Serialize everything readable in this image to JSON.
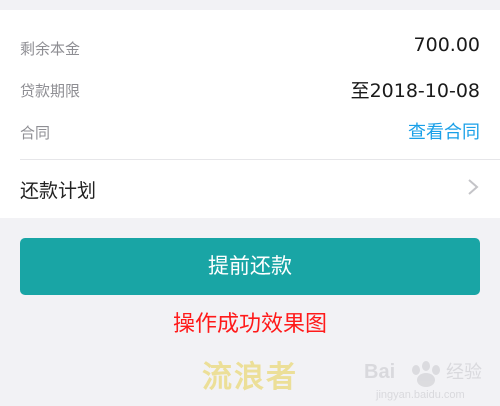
{
  "loan_details": {
    "remaining_principal": {
      "label": "剩余本金",
      "value": "700.00"
    },
    "loan_term": {
      "label": "贷款期限",
      "value": "至2018-10-08"
    },
    "contract": {
      "label": "合同",
      "link_text": "查看合同"
    }
  },
  "repayment_plan": {
    "label": "还款计划"
  },
  "early_repay_button": {
    "label": "提前还款"
  },
  "caption": "操作成功效果图",
  "watermark": {
    "center_text": "流浪者",
    "logo_text": "Bai经验",
    "logo_url": "jingyan.baidu.com"
  },
  "colors": {
    "button": "#19a5a5",
    "link": "#1aa0e8",
    "caption": "#ff1a1a",
    "watermark": "#ecdf98"
  },
  "icons": [
    "chevron-right-icon",
    "baidu-paw-icon"
  ]
}
